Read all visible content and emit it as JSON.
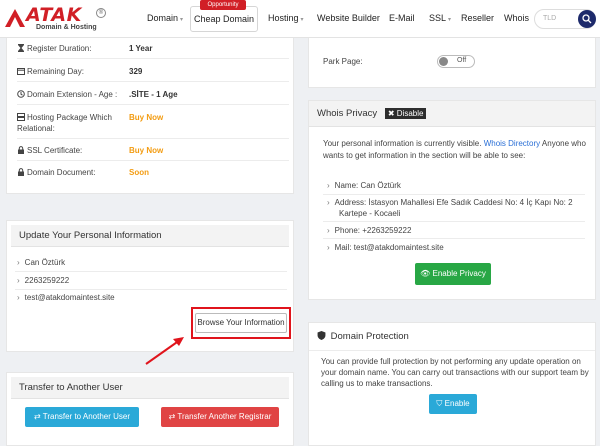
{
  "header": {
    "logo_text": "ATAK",
    "logo_sub": "Domain & Hosting",
    "nav": {
      "domain": "Domain",
      "cheap_domain": "Cheap Domain",
      "opportunity": "Opportunity",
      "hosting": "Hosting",
      "website_builder": "Website Builder",
      "email": "E-Mail",
      "ssl": "SSL",
      "reseller": "Reseller",
      "whois": "Whois"
    },
    "tld_placeholder": "TLD"
  },
  "domain_details": {
    "register_duration_label": "Register Duration:",
    "register_duration_value": "1 Year",
    "remaining_day_label": "Remaining Day:",
    "remaining_day_value": "329",
    "extension_label": "Domain Extension - Age :",
    "extension_value": ".SİTE - 1 Age",
    "hosting_label_1": "Hosting Package Which",
    "hosting_label_2": "Relational:",
    "hosting_value": "Buy Now",
    "ssl_label": "SSL Certificate:",
    "ssl_value": "Buy Now",
    "document_label": "Domain Document:",
    "document_value": "Soon"
  },
  "park_page": {
    "label": "Park Page:",
    "toggle_text": "Off"
  },
  "whois_privacy": {
    "title": "Whois Privacy",
    "disable_label": "Disable",
    "desc_1": "Your personal information is currently visible.",
    "desc_link": "Whois Directory",
    "desc_2": "Anyone who",
    "desc_3": "wants to get information in the section will be able to see:",
    "name": "Name: Can Öztürk",
    "address_1": "Address: İstasyon Mahallesi Efe Sadık Caddesi No: 4 İç Kapı No: 2",
    "address_2": "Kartepe - Kocaeli",
    "phone": "Phone: +2263259222",
    "mail": "Mail: test@atakdomaintest.site",
    "enable_button": "Enable Privacy"
  },
  "personal_info": {
    "title": "Update Your Personal Information",
    "name": "Can Öztürk",
    "phone": "2263259222",
    "email": "test@atakdomaintest.site",
    "browse_button": "Browse Your Information"
  },
  "domain_protection": {
    "title": "Domain Protection",
    "desc_1": "You can provide full protection by not performing any update operation on",
    "desc_2": "your domain name. You can carry out transactions with our support team by",
    "desc_3": "calling us to make transactions.",
    "enable_button": "Enable"
  },
  "transfer": {
    "title": "Transfer to Another User",
    "transfer_user_button": "Transfer to Another User",
    "transfer_registrar_button": "Transfer Another Registrar"
  },
  "colors": {
    "brand_red": "#d11f26",
    "highlight_red": "#e0141c",
    "green": "#28a745",
    "blue": "#2aa9d8"
  }
}
